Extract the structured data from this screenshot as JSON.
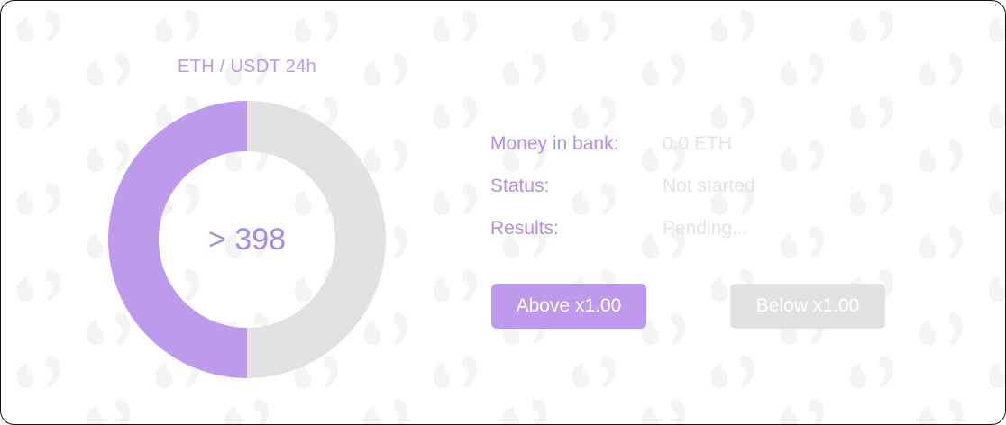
{
  "market": {
    "title": "ETH / USDT 24h",
    "center_value": "> 398",
    "split": {
      "above": 0.5,
      "below": 0.5
    },
    "colors": {
      "above": "#bd9aeb",
      "below": "#e2e2e2"
    }
  },
  "info": {
    "money_label": "Money in bank:",
    "money_value": "0.0 ETH",
    "status_label": "Status:",
    "status_value": "Not started",
    "results_label": "Results:",
    "results_value": "Pending..."
  },
  "actions": {
    "above_label": "Above x1.00",
    "below_label": "Below x1.00"
  }
}
